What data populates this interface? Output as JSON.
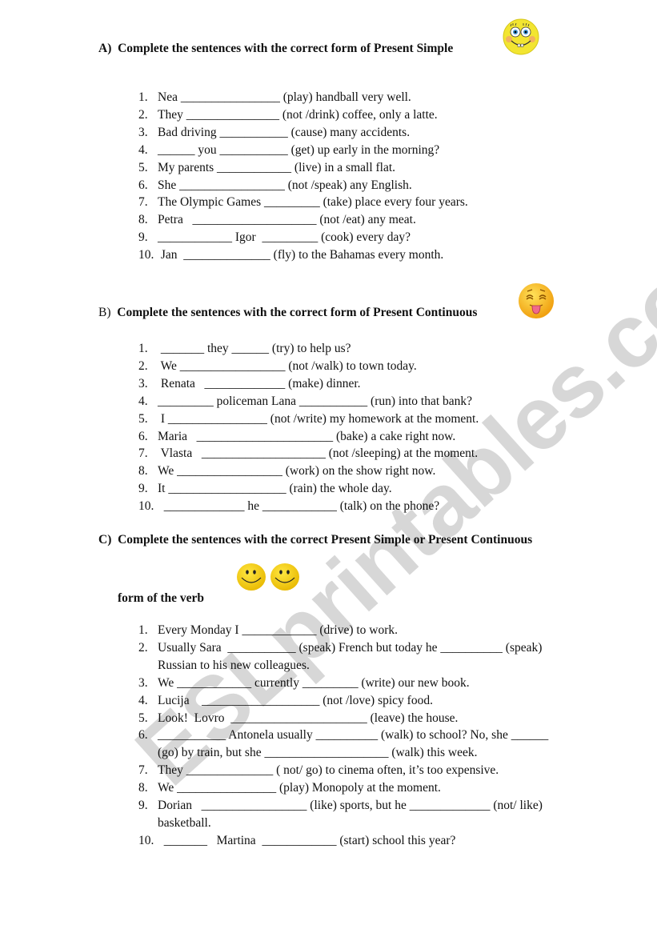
{
  "watermark": "ESLprintables.com",
  "sections": {
    "a": {
      "label": "A)",
      "title": "Complete the sentences with the correct form of Present Simple",
      "icon": "spongebob-smiley-icon",
      "items": [
        {
          "n": "1.",
          "text": "Nea ________________ (play) handball very well."
        },
        {
          "n": "2.",
          "text": "They _______________ (not /drink) coffee, only a latte."
        },
        {
          "n": "3.",
          "text": "Bad driving ___________ (cause) many accidents."
        },
        {
          "n": "4.",
          "text": "______ you ___________ (get) up early in the morning?"
        },
        {
          "n": "5.",
          "text": "My parents ____________ (live) in a small flat."
        },
        {
          "n": "6.",
          "text": "She _________________ (not /speak) any English."
        },
        {
          "n": "7.",
          "text": "The Olympic Games _________ (take) place every four years."
        },
        {
          "n": "8.",
          "text": "Petra   ____________________ (not /eat) any meat."
        },
        {
          "n": "9.",
          "text": "____________ Igor  _________ (cook) every day?"
        },
        {
          "n": "10.",
          "text": " Jan  ______________ (fly) to the Bahamas every month."
        }
      ]
    },
    "b": {
      "label": "B)",
      "title": "Complete the sentences with the correct form of Present Continuous",
      "icon": "tongue-out-emoji-icon",
      "items": [
        {
          "n": "1.",
          "text": " _______ they ______ (try) to help us?"
        },
        {
          "n": "2.",
          "text": " We _________________ (not /walk) to town today."
        },
        {
          "n": "3.",
          "text": " Renata   _____________ (make) dinner."
        },
        {
          "n": "4.",
          "text": "_________ policeman Lana ___________ (run) into that bank?"
        },
        {
          "n": "5.",
          "text": " I ________________ (not /write) my homework at the moment."
        },
        {
          "n": "6.",
          "text": "Maria   ______________________ (bake) a cake right now."
        },
        {
          "n": "7.",
          "text": " Vlasta   ____________________ (not /sleeping) at the moment."
        },
        {
          "n": "8.",
          "text": "We _________________ (work) on the show right now."
        },
        {
          "n": "9.",
          "text": "It ___________________ (rain) the whole day."
        },
        {
          "n": "10.",
          "text": "  _____________ he ____________ (talk) on the phone?"
        }
      ]
    },
    "c": {
      "label": "C)",
      "title": "Complete the sentences with the correct Present Simple  or Present Continuous",
      "subtitle": "form  of the verb",
      "icon": "two-smiley-faces-icon",
      "items": [
        {
          "n": "1.",
          "text": "Every Monday I ____________ (drive) to work."
        },
        {
          "n": "2.",
          "text": "Usually Sara  ___________ (speak) French but today he __________ (speak)",
          "cont": "Russian to his new colleagues."
        },
        {
          "n": "3.",
          "text": "We ____________ currently _________ (write) our new book."
        },
        {
          "n": "4.",
          "text": "Lucija    ___________________ (not /love) spicy food."
        },
        {
          "n": "5.",
          "text": "Look!  Lovro  ______________________ (leave) the house."
        },
        {
          "n": "6.",
          "text": "___________ Antonela usually __________ (walk) to school? No, she ______",
          "cont": "(go) by train, but she ____________________ (walk) this week."
        },
        {
          "n": "7.",
          "text": "They ______________ ( not/ go) to cinema often, it’s too expensive."
        },
        {
          "n": "8.",
          "text": "We ________________ (play) Monopoly at the moment."
        },
        {
          "n": "9.",
          "text": "Dorian   _________________ (like) sports, but he _____________ (not/ like)",
          "cont": "basketball."
        },
        {
          "n": "10.",
          "text": "  _______   Martina  ____________ (start) school this year?"
        }
      ]
    }
  }
}
